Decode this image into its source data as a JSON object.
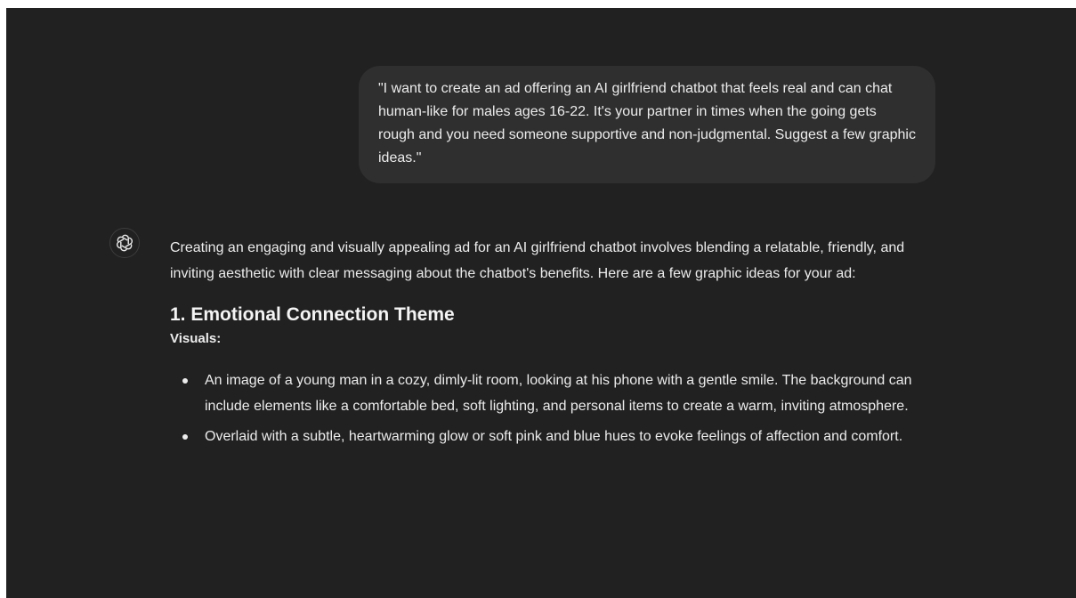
{
  "user_message": {
    "text": "\"I want to create an ad offering an AI girlfriend chatbot that feels real and can chat human-like for males ages 16-22. It's your partner in times when the going gets rough and you need someone supportive and non-judgmental. Suggest a few graphic ideas.\""
  },
  "assistant": {
    "avatar_icon": "openai-logo-icon",
    "intro": "Creating an engaging and visually appealing ad for an AI girlfriend chatbot involves blending a relatable, friendly, and inviting aesthetic with clear messaging about the chatbot's benefits. Here are a few graphic ideas for your ad:",
    "sections": [
      {
        "heading": "1. Emotional Connection Theme",
        "subheading": "Visuals:",
        "bullets": [
          "An image of a young man in a cozy, dimly-lit room, looking at his phone with a gentle smile. The background can include elements like a comfortable bed, soft lighting, and personal items to create a warm, inviting atmosphere.",
          "Overlaid with a subtle, heartwarming glow or soft pink and blue hues to evoke feelings of affection and comfort."
        ]
      }
    ]
  },
  "colors": {
    "background": "#212121",
    "user_bubble": "#2f2f2f",
    "text": "#ececec"
  }
}
